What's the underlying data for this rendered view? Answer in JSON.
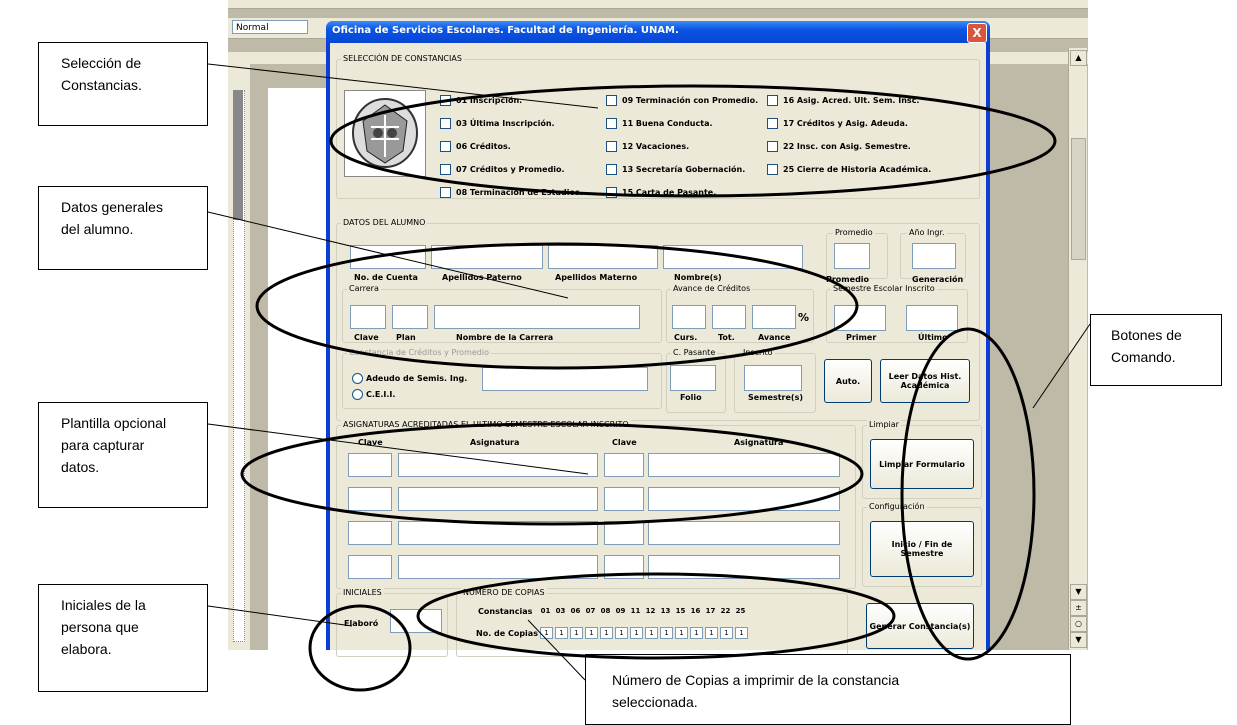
{
  "word": {
    "style_value": "Normal"
  },
  "dialog": {
    "title": "Oficina de Servicios Escolares.  Facultad de Ingeniería.  UNAM.",
    "close_label": "X"
  },
  "constancias": {
    "group_title": "SELECCIÓN DE CONSTANCIAS",
    "items": [
      "01 Inscripción.",
      "03 Última Inscripción.",
      "06 Créditos.",
      "07 Créditos y Promedio.",
      "08 Terminación de Estudios.",
      "09 Terminación con Promedio.",
      "11 Buena Conducta.",
      "12 Vacaciones.",
      "13 Secretaría Gobernación.",
      "15 Carta de Pasante.",
      "16 Asig. Acred. Ult. Sem. Insc.",
      "17 Créditos y Asig. Adeuda.",
      "22 Insc. con Asig. Semestre.",
      "25 Cierre de Historia Académica."
    ]
  },
  "alumno": {
    "group_title": "DATOS DEL ALUMNO",
    "no_cuenta": "No. de Cuenta",
    "ap_paterno": "Apellidos Paterno",
    "ap_materno": "Apellidos Materno",
    "nombre": "Nombre(s)",
    "promedio_group": "Promedio",
    "promedio": "Promedio",
    "anio_group": "Año Ingr.",
    "generacion": "Generación",
    "carrera_group": "Carrera",
    "clave": "Clave",
    "plan": "Plan",
    "nombre_carrera": "Nombre de la Carrera",
    "avance_group": "Avance de Créditos",
    "curs": "Curs.",
    "tot": "Tot.",
    "avance": "Avance",
    "pct": "%",
    "semestre_group": "Semestre Escolar Inscrito",
    "primer": "Primer",
    "ultimo": "Último",
    "const_group": "Constancia de Créditos y Promedio",
    "radio1": "Adeudo de Semis. Ing.",
    "radio2": "C.E.I.I.",
    "cpasante_group": "C. Pasante",
    "folio": "Folio",
    "inscrito_group": "Inscrito",
    "semestres": "Semestre(s)",
    "auto_btn": "Auto.",
    "leer_btn": "Leer Datos Hist. Académica"
  },
  "asignaturas": {
    "group_title": "ASIGNATURAS ACREDITADAS EL ULTIMO SEMESTRE ESCOLAR INSCRITO",
    "clave1": "Clave",
    "asig1": "Asignatura",
    "clave2": "Clave",
    "asig2": "Asignatura"
  },
  "comandos": {
    "limpiar_group": "Limpiar",
    "limpiar_btn": "Limpiar Formulario",
    "config_group": "Configuración",
    "inicio_btn": "Inicio / Fin de Semestre",
    "generar_btn": "Generar Constancia(s)"
  },
  "iniciales": {
    "group_title": "INICIALES",
    "elaboro": "Elaboró"
  },
  "copias": {
    "group_title": "NÚMERO DE COPIAS",
    "constancias_label": "Constancias",
    "no_copias_label": "No. de Copias",
    "codes": [
      "01",
      "03",
      "06",
      "07",
      "08",
      "09",
      "11",
      "12",
      "13",
      "15",
      "16",
      "17",
      "22",
      "25"
    ],
    "values": [
      "1",
      "1",
      "1",
      "1",
      "1",
      "1",
      "1",
      "1",
      "1",
      "1",
      "1",
      "1",
      "1",
      "1"
    ]
  },
  "callouts": {
    "seleccion": [
      "Selección de",
      "Constancias."
    ],
    "datos": [
      "Datos generales",
      "del alumno."
    ],
    "plantilla": [
      "Plantilla opcional",
      "para capturar",
      "datos."
    ],
    "iniciales": [
      "Iniciales de la",
      "persona que",
      "elabora."
    ],
    "botones": [
      "Botones de",
      "Comando."
    ],
    "numero": [
      "Número de Copias a imprimir de la constancia",
      "seleccionada."
    ]
  }
}
